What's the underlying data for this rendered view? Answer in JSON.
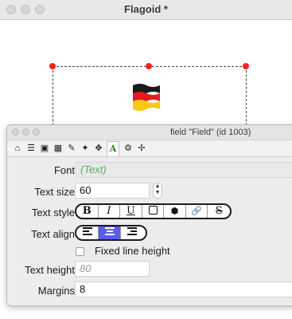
{
  "window": {
    "title": "Flagoid *"
  },
  "palette": {
    "title": "field \"Field\" (id 1003)",
    "toolbar_icons": [
      "home-icon",
      "list-icon",
      "database-icon",
      "table-icon",
      "pencil-icon",
      "magic-wand-icon",
      "move-icon",
      "text-icon",
      "gears-icon",
      "geometry-icon"
    ],
    "active_tab": "text-icon"
  },
  "form": {
    "font_label": "Font",
    "font_value": "(Text)",
    "text_size_label": "Text size",
    "text_size_value": "60",
    "text_style_label": "Text style",
    "style_buttons": [
      "B",
      "I",
      "U",
      "",
      "",
      "",
      "S"
    ],
    "text_align_label": "Text align",
    "align_selected": "center",
    "fixed_line_height_label": "Fixed line height",
    "fixed_line_height_checked": false,
    "text_height_label": "Text height",
    "text_height_placeholder": "80",
    "margins_label": "Margins",
    "margins_value": "8"
  },
  "colors": {
    "handle": "#ff1f1f",
    "selected_segment": "#5b5bf0",
    "font_text": "#5fa85f"
  }
}
